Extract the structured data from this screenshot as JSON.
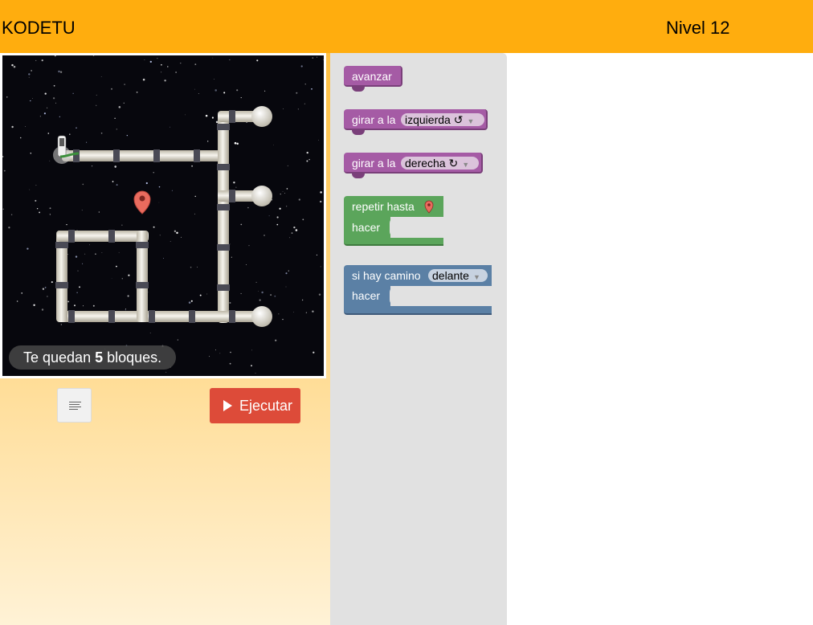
{
  "header": {
    "app_title": "KODETU",
    "level_label": "Nivel 12"
  },
  "maze": {
    "capacity_prefix": "Te quedan ",
    "capacity_count": "5",
    "capacity_suffix": " bloques."
  },
  "controls": {
    "code_icon": "show-code-icon",
    "run_label": "Ejecutar",
    "run_icon": "play-icon"
  },
  "toolbox": {
    "move_forward": "avanzar",
    "turn_left_prefix": "girar a la",
    "turn_left_value": "izquierda ↺",
    "turn_right_prefix": "girar a la",
    "turn_right_value": "derecha ↻",
    "repeat_label": "repetir hasta",
    "repeat_do": "hacer",
    "if_label": "si hay camino",
    "if_value": "delante",
    "if_do": "hacer"
  },
  "colors": {
    "header": "#ffad0e",
    "action_block": "#a55ba5",
    "loop_block": "#5ba55b",
    "logic_block": "#5b80a5",
    "run_button": "#dd4b39"
  }
}
